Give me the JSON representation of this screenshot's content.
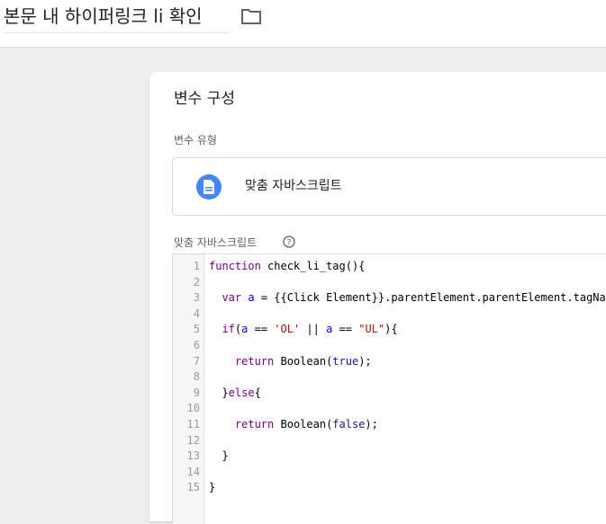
{
  "header": {
    "title": "본문 내 하이퍼링크 li 확인",
    "folder_icon": "folder-icon"
  },
  "card": {
    "title": "변수 구성",
    "variable_type_label": "변수 유형",
    "variable_type_value": "맞춤 자바스크립트",
    "variable_type_icon": "document-icon",
    "script_label": "맞춤 자바스크립트",
    "help_icon": "help-icon"
  },
  "editor": {
    "lines": [
      {
        "n": "1",
        "t": "function check_li_tag(){"
      },
      {
        "n": "2",
        "t": ""
      },
      {
        "n": "3",
        "t": "  var a = {{Click Element}}.parentElement.parentElement.tagName;"
      },
      {
        "n": "4",
        "t": ""
      },
      {
        "n": "5",
        "t": "  if(a == 'OL' || a == \"UL\"){"
      },
      {
        "n": "6",
        "t": ""
      },
      {
        "n": "7",
        "t": "    return Boolean(true);"
      },
      {
        "n": "8",
        "t": ""
      },
      {
        "n": "9",
        "t": "  }else{"
      },
      {
        "n": "10",
        "t": ""
      },
      {
        "n": "11",
        "t": "    return Boolean(false);"
      },
      {
        "n": "12",
        "t": ""
      },
      {
        "n": "13",
        "t": "  }"
      },
      {
        "n": "14",
        "t": ""
      },
      {
        "n": "15",
        "t": "}"
      }
    ]
  },
  "colors": {
    "accent": "#4285f4",
    "keyword": "#770088",
    "variable": "#0000ff",
    "string": "#aa1111",
    "atom": "#221199"
  }
}
